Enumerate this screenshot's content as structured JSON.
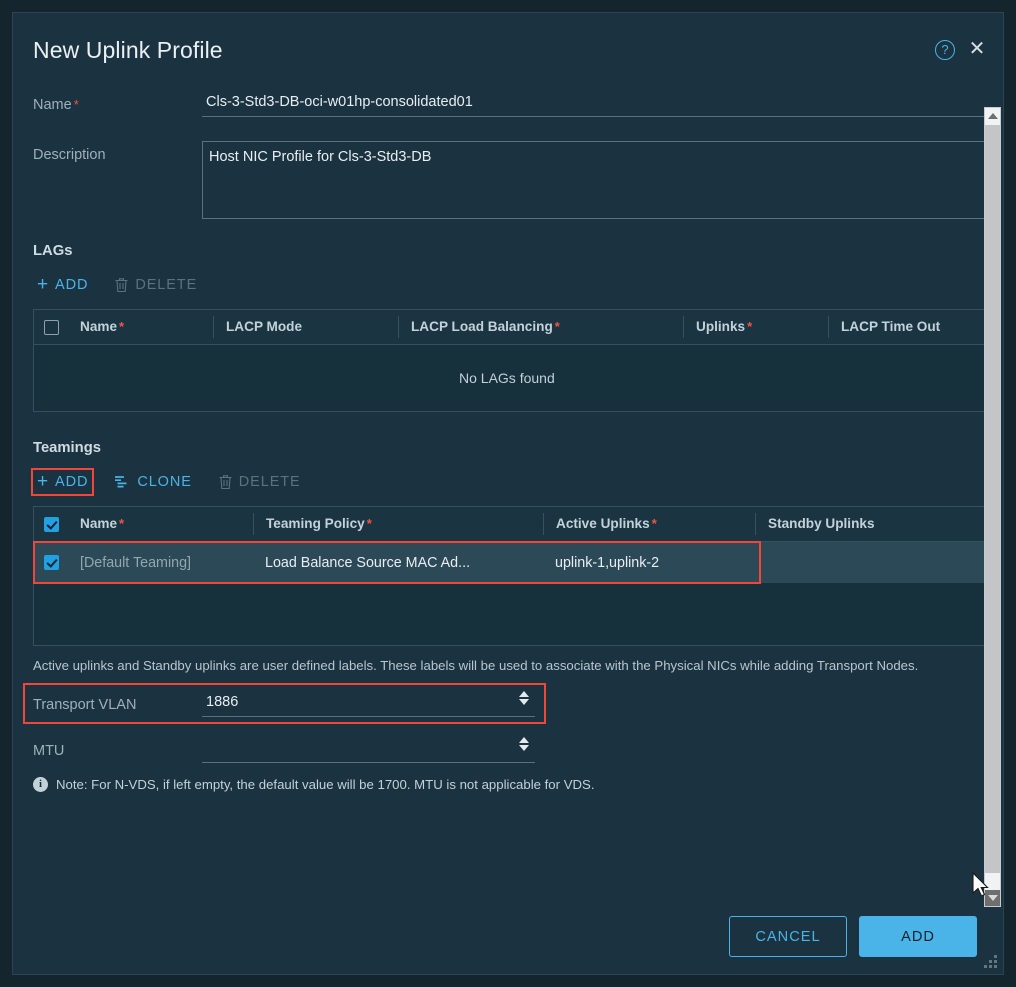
{
  "dialog": {
    "title": "New Uplink Profile",
    "help_icon": "help-circle-icon",
    "close_icon": "close-icon"
  },
  "form": {
    "name": {
      "label": "Name",
      "required": true,
      "value": "Cls-3-Std3-DB-oci-w01hp-consolidated01"
    },
    "description": {
      "label": "Description",
      "required": false,
      "value": "Host NIC Profile for Cls-3-Std3-DB"
    },
    "transport_vlan": {
      "label": "Transport VLAN",
      "value": "1886",
      "highlighted": true
    },
    "mtu": {
      "label": "MTU",
      "value": "",
      "highlighted": false
    }
  },
  "lags": {
    "section_title": "LAGs",
    "toolbar": [
      {
        "label": "ADD",
        "icon": "plus-icon",
        "enabled": true,
        "highlighted": false
      },
      {
        "label": "DELETE",
        "icon": "trash-icon",
        "enabled": false,
        "highlighted": false
      }
    ],
    "columns": [
      {
        "label": "Name",
        "required": true
      },
      {
        "label": "LACP Mode",
        "required": false
      },
      {
        "label": "LACP Load Balancing",
        "required": true
      },
      {
        "label": "Uplinks",
        "required": true
      },
      {
        "label": "LACP Time Out",
        "required": false
      }
    ],
    "header_checkbox_checked": false,
    "empty_text": "No LAGs found",
    "rows": []
  },
  "teamings": {
    "section_title": "Teamings",
    "toolbar": [
      {
        "label": "ADD",
        "icon": "plus-icon",
        "enabled": true,
        "highlighted": true
      },
      {
        "label": "CLONE",
        "icon": "clone-icon",
        "enabled": true,
        "highlighted": false
      },
      {
        "label": "DELETE",
        "icon": "trash-icon",
        "enabled": false,
        "highlighted": false
      }
    ],
    "columns": [
      {
        "label": "Name",
        "required": true
      },
      {
        "label": "Teaming Policy",
        "required": true
      },
      {
        "label": "Active Uplinks",
        "required": true
      },
      {
        "label": "Standby Uplinks",
        "required": false
      }
    ],
    "header_checkbox_checked": true,
    "rows": [
      {
        "checked": true,
        "name": "[Default Teaming]",
        "teaming_policy": "Load Balance Source MAC Ad...",
        "active_uplinks": "uplink-1,uplink-2",
        "standby_uplinks": "",
        "highlighted": true
      }
    ]
  },
  "hints": {
    "uplinks_hint": "Active uplinks and Standby uplinks are user defined labels. These labels will be used to associate with the Physical NICs while adding Transport Nodes.",
    "mtu_note": "Note: For N-VDS, if left empty, the default value will be 1700. MTU is not applicable for VDS.",
    "info_icon": "info-icon"
  },
  "footer": {
    "cancel_label": "CANCEL",
    "add_label": "ADD"
  },
  "colors": {
    "accent": "#4ab3e8",
    "required_marker": "#f15642",
    "highlight_box": "#f4453a",
    "dialog_bg": "#1b3340",
    "page_bg": "#14252e"
  }
}
